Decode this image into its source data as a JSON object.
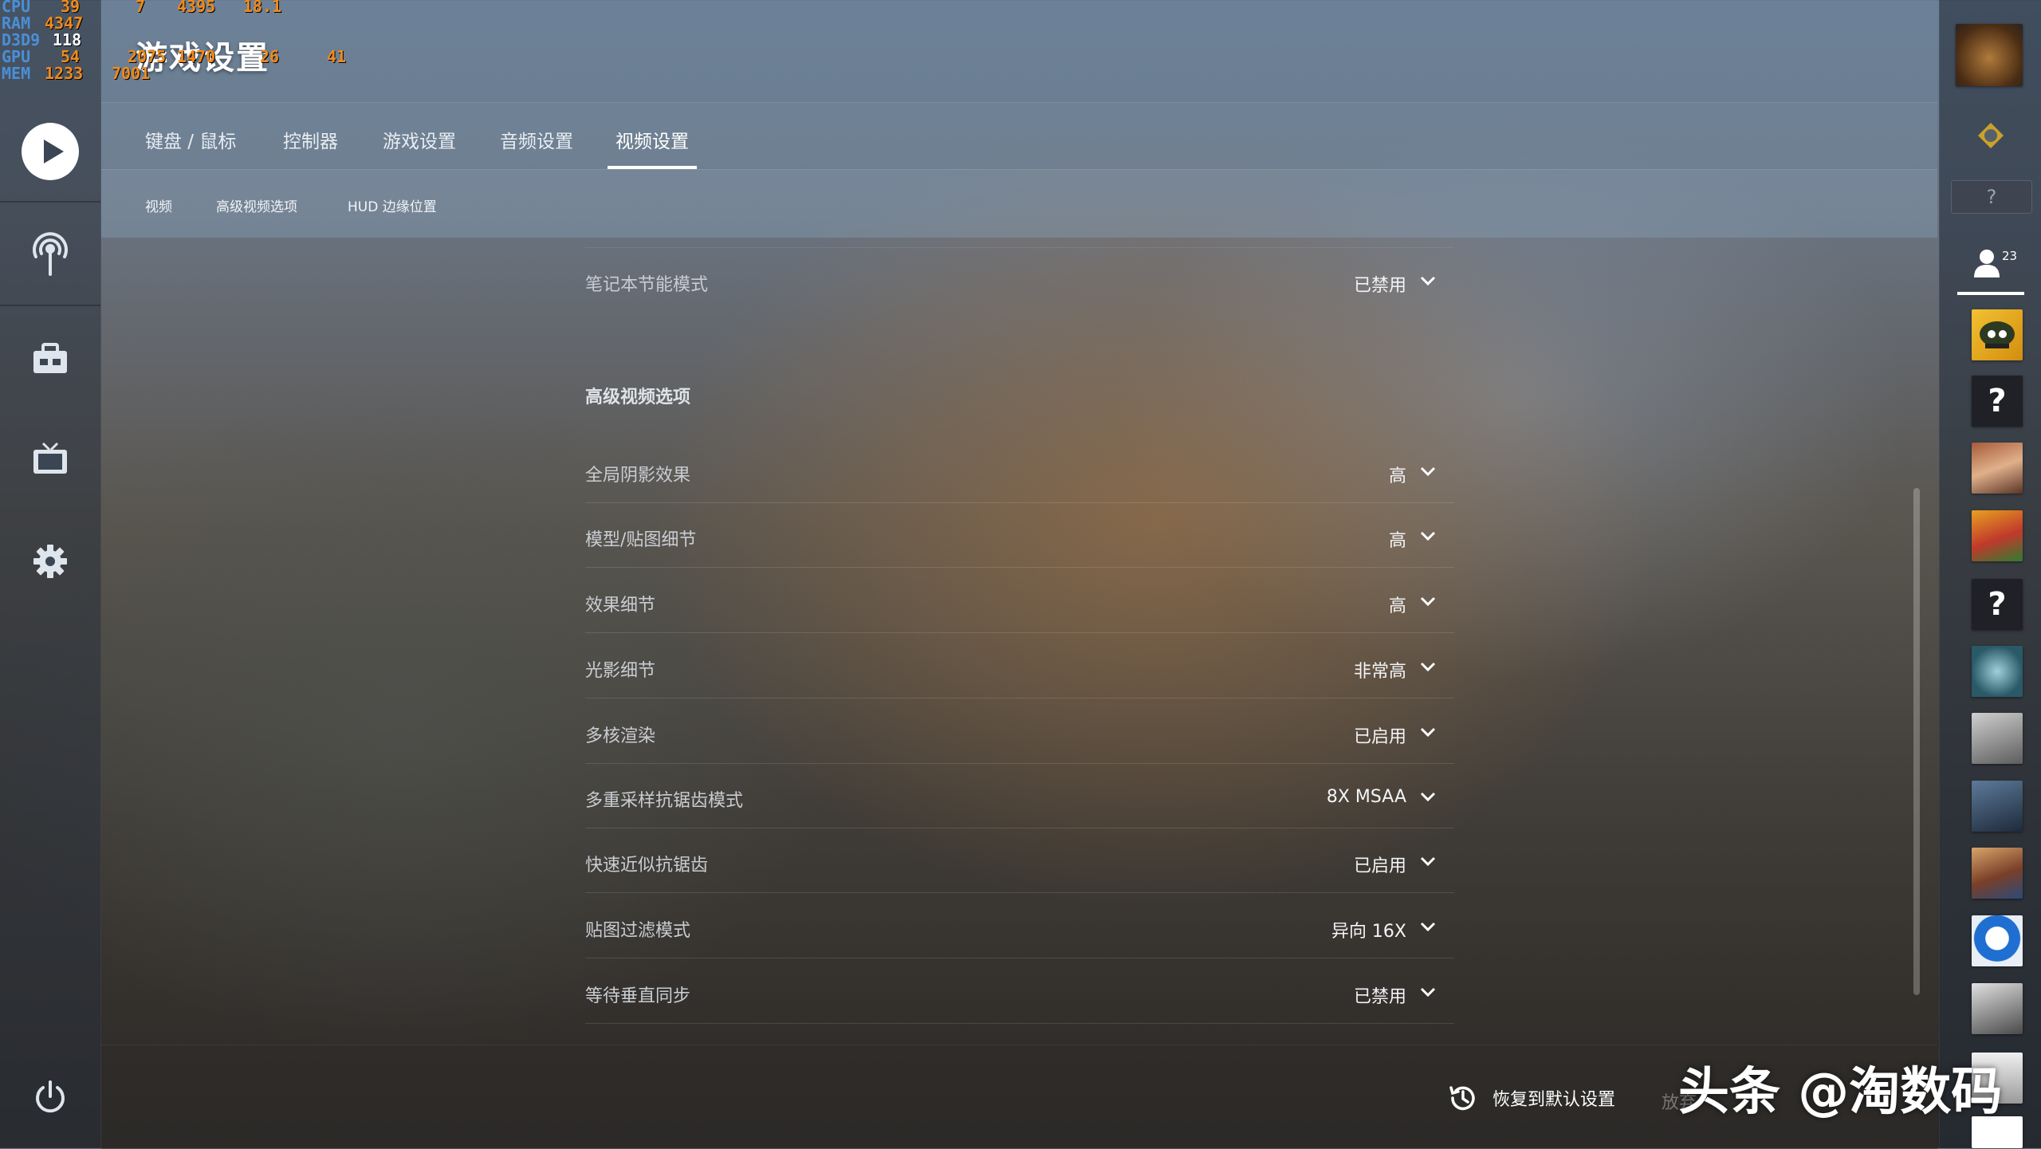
{
  "overlay": {
    "labels": [
      "CPU",
      "RAM",
      "D3D9",
      "GPU",
      "MEM"
    ],
    "cpu_usage": "39",
    "cpu_temp": "7",
    "cpu_clock": "4395",
    "cpu_power": "18.1",
    "ram_used": "4347",
    "fps": "118",
    "gpu_usage": "54",
    "gpu_clock": "2075",
    "gpu_temp": "1470",
    "gpu_power": "26",
    "gpu_fan": "41",
    "mem_used": "1233",
    "mem_clock": "7001"
  },
  "page": {
    "title": "游戏设置"
  },
  "tabs": [
    {
      "label": "键盘 / 鼠标",
      "active": false
    },
    {
      "label": "控制器",
      "active": false
    },
    {
      "label": "游戏设置",
      "active": false
    },
    {
      "label": "音频设置",
      "active": false
    },
    {
      "label": "视频设置",
      "active": true
    }
  ],
  "subtabs": [
    {
      "label": "视频"
    },
    {
      "label": "高级视频选项"
    },
    {
      "label": "HUD 边缘位置"
    }
  ],
  "top_setting": {
    "name": "笔记本节能模式",
    "value": "已禁用"
  },
  "section": {
    "title": "高级视频选项"
  },
  "settings": [
    {
      "name": "全局阴影效果",
      "value": "高"
    },
    {
      "name": "模型/贴图细节",
      "value": "高"
    },
    {
      "name": "效果细节",
      "value": "高"
    },
    {
      "name": "光影细节",
      "value": "非常高"
    },
    {
      "name": "多核渲染",
      "value": "已启用"
    },
    {
      "name": "多重采样抗锯齿模式",
      "value": "8X MSAA"
    },
    {
      "name": "快速近似抗锯齿",
      "value": "已启用"
    },
    {
      "name": "贴图过滤模式",
      "value": "异向 16X"
    },
    {
      "name": "等待垂直同步",
      "value": "已禁用"
    }
  ],
  "footer": {
    "restore_label": "恢复到默认设置",
    "discard_label": "放弃"
  },
  "watermark": "头条 @淘数码",
  "friends": {
    "count": "23",
    "unknown_mark": "?"
  },
  "colors": {
    "overlay_label": "#4a8fd6",
    "overlay_value": "#f08a1c",
    "tab_underline": "#ffffff"
  }
}
